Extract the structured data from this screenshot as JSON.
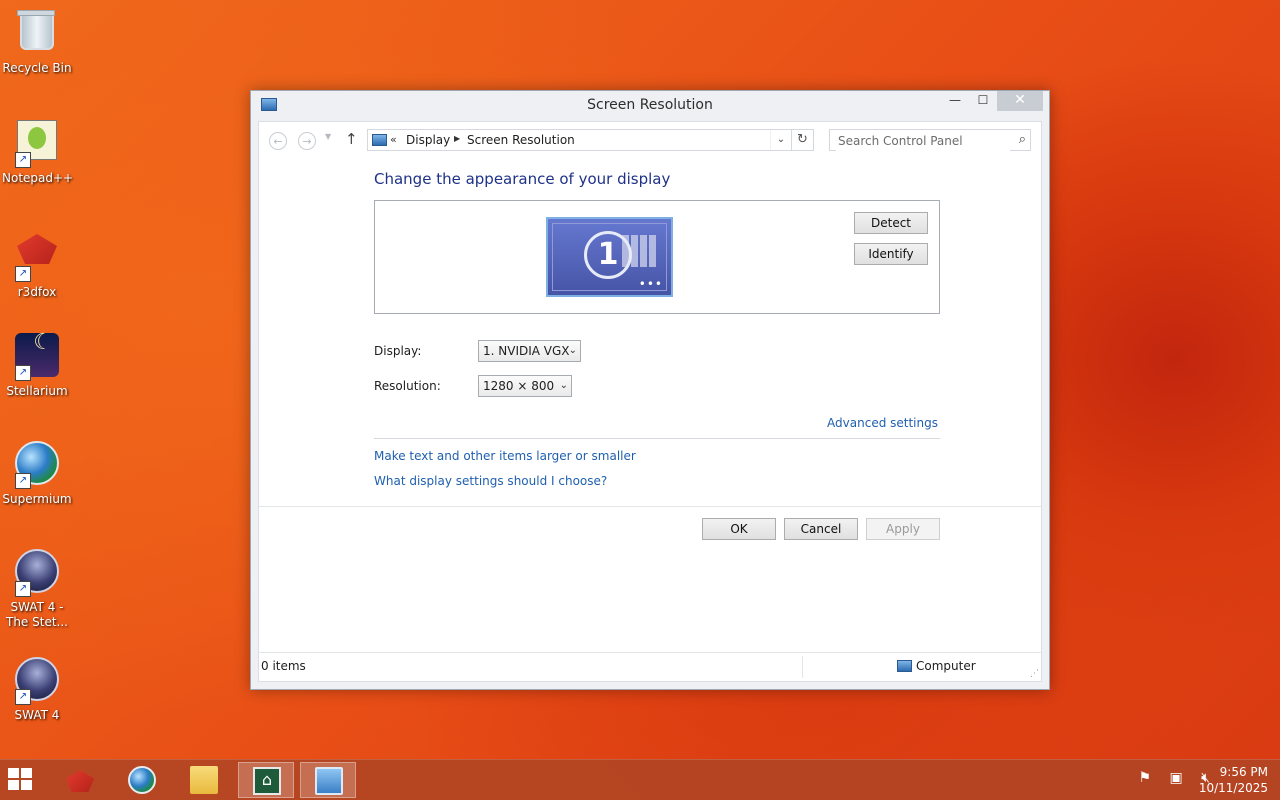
{
  "desktop": {
    "icons": [
      {
        "label": "Recycle Bin"
      },
      {
        "label": "Notepad++"
      },
      {
        "label": "r3dfox"
      },
      {
        "label": "Stellarium"
      },
      {
        "label": "Supermium"
      },
      {
        "label": "SWAT 4 - The Stet..."
      },
      {
        "label": "SWAT 4"
      }
    ]
  },
  "window": {
    "title": "Screen Resolution",
    "controls": {
      "minimize": "—",
      "maximize": "☐",
      "close": "✕"
    },
    "nav": {
      "back_icon": "back-arrow-icon",
      "forward_icon": "forward-arrow-icon",
      "breadcrumb_prefix": "«",
      "breadcrumbs": [
        "Display",
        "Screen Resolution"
      ],
      "search_placeholder": "Search Control Panel"
    },
    "heading": "Change the appearance of your display",
    "monitor": {
      "number": "1"
    },
    "buttons": {
      "detect": "Detect",
      "identify": "Identify",
      "ok": "OK",
      "cancel": "Cancel",
      "apply": "Apply"
    },
    "fields": {
      "display_label": "Display:",
      "display_value": "1. NVIDIA VGX",
      "resolution_label": "Resolution:",
      "resolution_value": "1280 × 800"
    },
    "links": {
      "advanced": "Advanced settings",
      "text_size": "Make text and other items larger or smaller",
      "which_settings": "What display settings should I choose?"
    },
    "status": {
      "items": "0 items",
      "location": "Computer"
    }
  },
  "taskbar": {
    "clock_time": "9:56 PM",
    "clock_date": "10/11/2025"
  },
  "colors": {
    "heading": "#1e3287",
    "link": "#1f5fae",
    "desktop_accent": "#e84e16"
  }
}
